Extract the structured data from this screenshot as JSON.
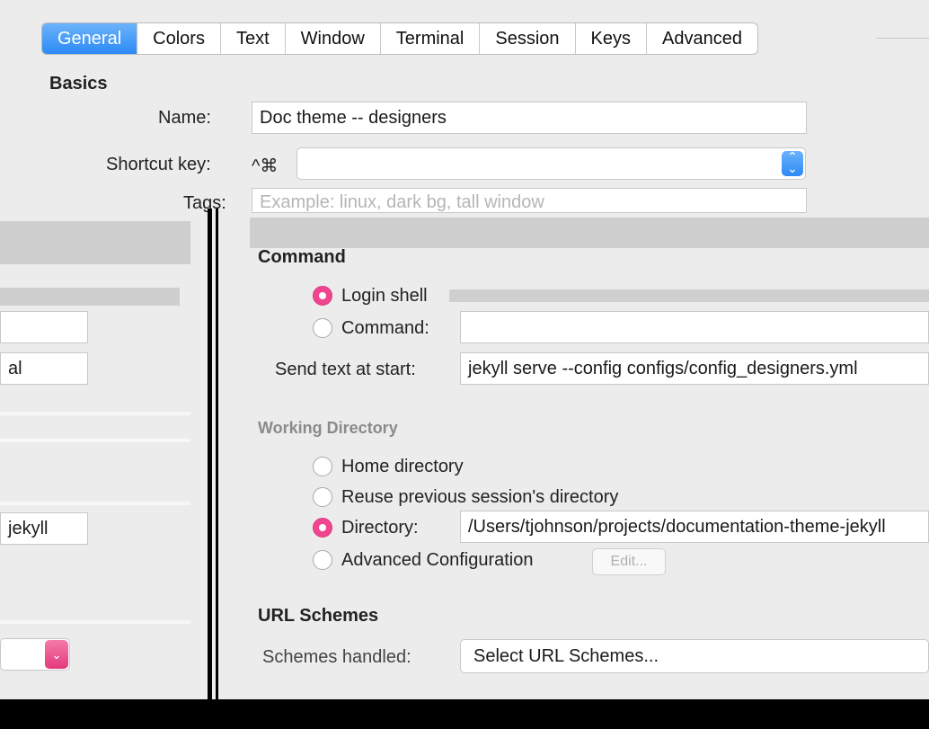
{
  "tabs": [
    {
      "label": "General",
      "active": true
    },
    {
      "label": "Colors"
    },
    {
      "label": "Text"
    },
    {
      "label": "Window"
    },
    {
      "label": "Terminal"
    },
    {
      "label": "Session"
    },
    {
      "label": "Keys"
    },
    {
      "label": "Advanced"
    }
  ],
  "basics": {
    "heading": "Basics",
    "name_label": "Name:",
    "name_value": "Doc theme -- designers",
    "shortcut_label": "Shortcut key:",
    "shortcut_prefix": "^⌘",
    "tags_label": "Tags:",
    "tags_placeholder": "Example: linux, dark bg, tall window"
  },
  "command": {
    "heading": "Command",
    "login_shell": "Login shell",
    "command_label": "Command:",
    "command_value": "",
    "send_text_label": "Send text at start:",
    "send_text_value": "jekyll serve --config configs/config_designers.yml",
    "selected": "login_shell"
  },
  "working_directory": {
    "heading": "Working Directory",
    "home": "Home directory",
    "reuse": "Reuse previous session's directory",
    "directory_label": "Directory:",
    "directory_value": "/Users/tjohnson/projects/documentation-theme-jekyll",
    "advanced": "Advanced Configuration",
    "edit_button": "Edit...",
    "selected": "directory"
  },
  "url_schemes": {
    "heading": "URL Schemes",
    "handled_label": "Schemes handled:",
    "select_value": "Select URL Schemes..."
  },
  "left_fragment": {
    "field2_text": "al",
    "field3_text": "jekyll"
  },
  "colors": {
    "accent_blue": "#2c8af5",
    "radio_pink": "#f0468f"
  }
}
